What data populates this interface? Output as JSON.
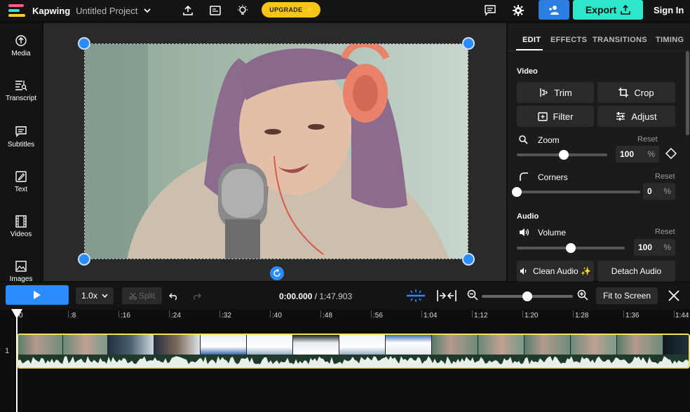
{
  "header": {
    "brand": "Kapwing",
    "project_title": "Untitled Project",
    "upgrade_label": "UPGRADE ✨",
    "export_label": "Export",
    "signin_label": "Sign In"
  },
  "sidebar": {
    "items": [
      {
        "label": "Media",
        "icon": "upload-icon"
      },
      {
        "label": "Transcript",
        "icon": "transcript-icon"
      },
      {
        "label": "Subtitles",
        "icon": "subtitles-icon"
      },
      {
        "label": "Text",
        "icon": "text-icon"
      },
      {
        "label": "Videos",
        "icon": "film-icon"
      },
      {
        "label": "Images",
        "icon": "image-icon"
      }
    ]
  },
  "panel": {
    "tabs": [
      "EDIT",
      "EFFECTS",
      "TRANSITIONS",
      "TIMING"
    ],
    "active_tab": "EDIT",
    "video_section": "Video",
    "buttons": {
      "trim": "Trim",
      "crop": "Crop",
      "filter": "Filter",
      "adjust": "Adjust"
    },
    "zoom": {
      "label": "Zoom",
      "reset": "Reset",
      "value": "100",
      "unit": "%",
      "level": 0.5
    },
    "corners": {
      "label": "Corners",
      "reset": "Reset",
      "value": "0",
      "unit": "%",
      "level": 0.0
    },
    "audio_section": "Audio",
    "volume": {
      "label": "Volume",
      "reset": "Reset",
      "value": "100",
      "unit": "%",
      "level": 0.5
    },
    "clean_audio": "Clean Audio ✨",
    "detach_audio": "Detach Audio"
  },
  "timeline": {
    "speed": "1.0x",
    "split": "Split",
    "current_time": "0:00.000",
    "separator": "/",
    "duration": "1:47.903",
    "fit_label": "Fit to Screen",
    "zoom_level": 0.5,
    "ruler": [
      "0",
      ":8",
      ":16",
      ":24",
      ":32",
      ":40",
      ":48",
      ":56",
      "1:04",
      "1:12",
      "1:20",
      "1:28",
      "1:36",
      "1:44"
    ],
    "track_number": "1"
  },
  "colors": {
    "accent_blue": "#2a8cff",
    "export_teal": "#2ee6c9",
    "upgrade_yellow": "#f5c518",
    "track_border": "#f5e05a"
  }
}
